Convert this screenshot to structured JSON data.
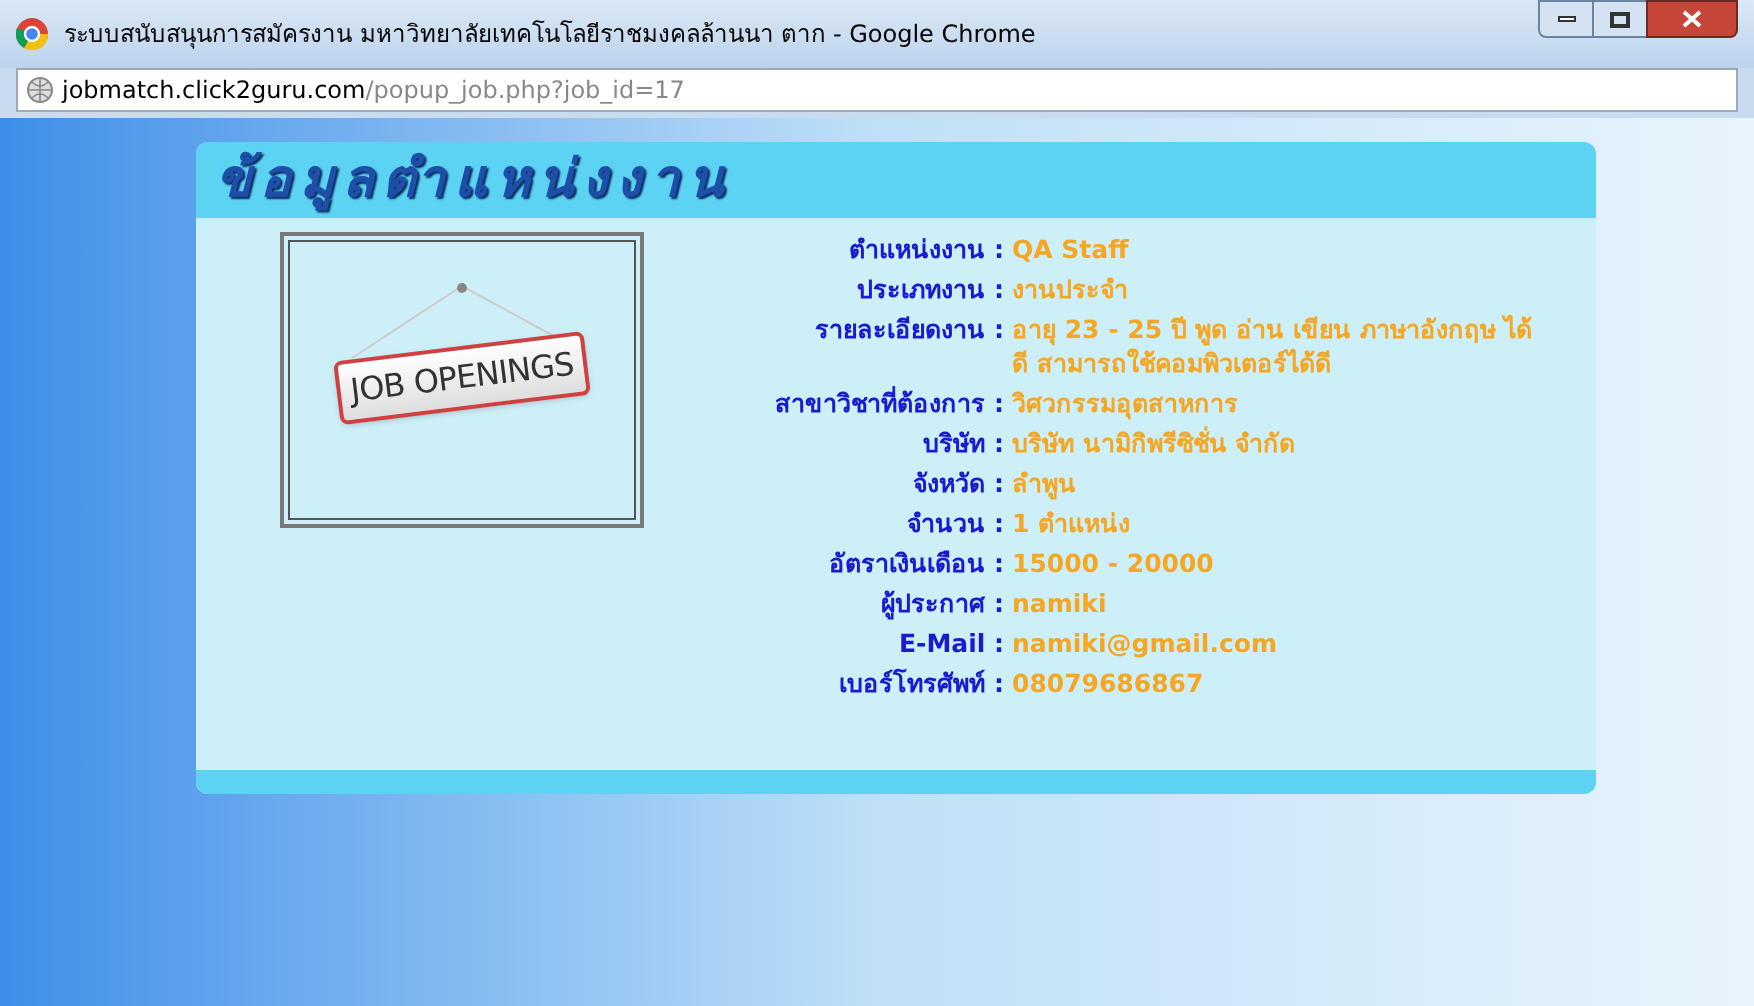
{
  "window": {
    "title": "ระบบสนับสนุนการสมัครงาน มหาวิทยาลัยเทคโนโลยีราชมงคลล้านนา ตาก - Google Chrome"
  },
  "address_bar": {
    "domain": "jobmatch.click2guru.com",
    "path": "/popup_job.php?job_id=17"
  },
  "panel": {
    "heading": "ข้อมูลตำแหน่งงาน",
    "sign_text": "JOB OPENINGS",
    "fields": [
      {
        "label": "ตำแหน่งงาน :",
        "value": "QA Staff"
      },
      {
        "label": "ประเภทงาน :",
        "value": "งานประจำ"
      },
      {
        "label": "รายละเอียดงาน :",
        "value": "อายุ 23 - 25 ปี พูด อ่าน เขียน ภาษาอังกฤษ ได้ดี สามารถใช้คอมพิวเตอร์ได้ดี"
      },
      {
        "label": "สาขาวิชาที่ต้องการ :",
        "value": "วิศวกรรมอุตสาหการ"
      },
      {
        "label": "บริษัท :",
        "value": "บริษัท นามิกิพรีซิชั่น จำกัด"
      },
      {
        "label": "จังหวัด :",
        "value": "ลำพูน"
      },
      {
        "label": "จำนวน :",
        "value": "**1** ตำแหน่ง"
      },
      {
        "label": "อัตราเงินเดือน :",
        "value": "15000 - 20000"
      },
      {
        "label": "ผู้ประกาศ :",
        "value": "namiki"
      },
      {
        "label": "E-Mail :",
        "value": "namiki@gmail.com"
      },
      {
        "label": "เบอร์โทรศัพท์ :",
        "value": "08079686867"
      }
    ]
  }
}
